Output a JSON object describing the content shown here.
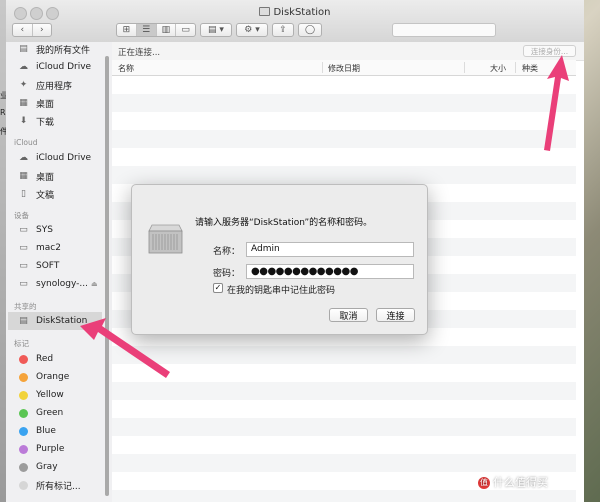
{
  "window": {
    "title": "DiskStation"
  },
  "background": {
    "fragments": [
      "业",
      "R",
      "件"
    ]
  },
  "pathbar": {
    "status": "正在连接...",
    "connect_as": "连接身份..."
  },
  "columns": {
    "name": "名称",
    "modified": "修改日期",
    "size": "大小",
    "kind": "种类"
  },
  "sidebar": {
    "favorites": [
      {
        "label": "我的所有文件",
        "icon": "all-files-icon"
      },
      {
        "label": "iCloud Drive",
        "icon": "cloud-icon"
      },
      {
        "label": "应用程序",
        "icon": "applications-icon"
      },
      {
        "label": "桌面",
        "icon": "desktop-icon"
      },
      {
        "label": "下载",
        "icon": "download-icon"
      }
    ],
    "icloud_header": "iCloud",
    "icloud": [
      {
        "label": "iCloud Drive",
        "icon": "cloud-icon"
      },
      {
        "label": "桌面",
        "icon": "desktop-icon"
      },
      {
        "label": "文稿",
        "icon": "document-icon"
      }
    ],
    "devices_header": "设备",
    "devices": [
      {
        "label": "SYS",
        "icon": "drive-icon"
      },
      {
        "label": "mac2",
        "icon": "drive-icon"
      },
      {
        "label": "SOFT",
        "icon": "drive-icon"
      },
      {
        "label": "synology-...",
        "icon": "drive-icon"
      }
    ],
    "shared_header": "共享的",
    "shared": [
      {
        "label": "DiskStation",
        "icon": "server-icon"
      }
    ],
    "tags_header": "标记",
    "tags": [
      {
        "label": "Red",
        "color": "#f05a57"
      },
      {
        "label": "Orange",
        "color": "#f5a33a"
      },
      {
        "label": "Yellow",
        "color": "#f1d33a"
      },
      {
        "label": "Green",
        "color": "#5bc553"
      },
      {
        "label": "Blue",
        "color": "#3aa3f0"
      },
      {
        "label": "Purple",
        "color": "#bb7bd8"
      },
      {
        "label": "Gray",
        "color": "#9c9c9c"
      },
      {
        "label": "所有标记...",
        "color": "#d6d6d6"
      }
    ]
  },
  "dialog": {
    "message": "请输入服务器“DiskStation”的名称和密码。",
    "name_label": "名称：",
    "name_value": "Admin",
    "password_label": "密码：",
    "password_value": "●●●●●●●●●●●●●",
    "remember_label": "在我的钥匙串中记住此密码",
    "remember_checked": true,
    "cancel_label": "取消",
    "connect_label": "连接"
  },
  "watermark": {
    "badge": "值",
    "text": "什么值得买"
  },
  "accent": {
    "arrow": "#ea3f79",
    "selection": "#d7d7d7"
  }
}
